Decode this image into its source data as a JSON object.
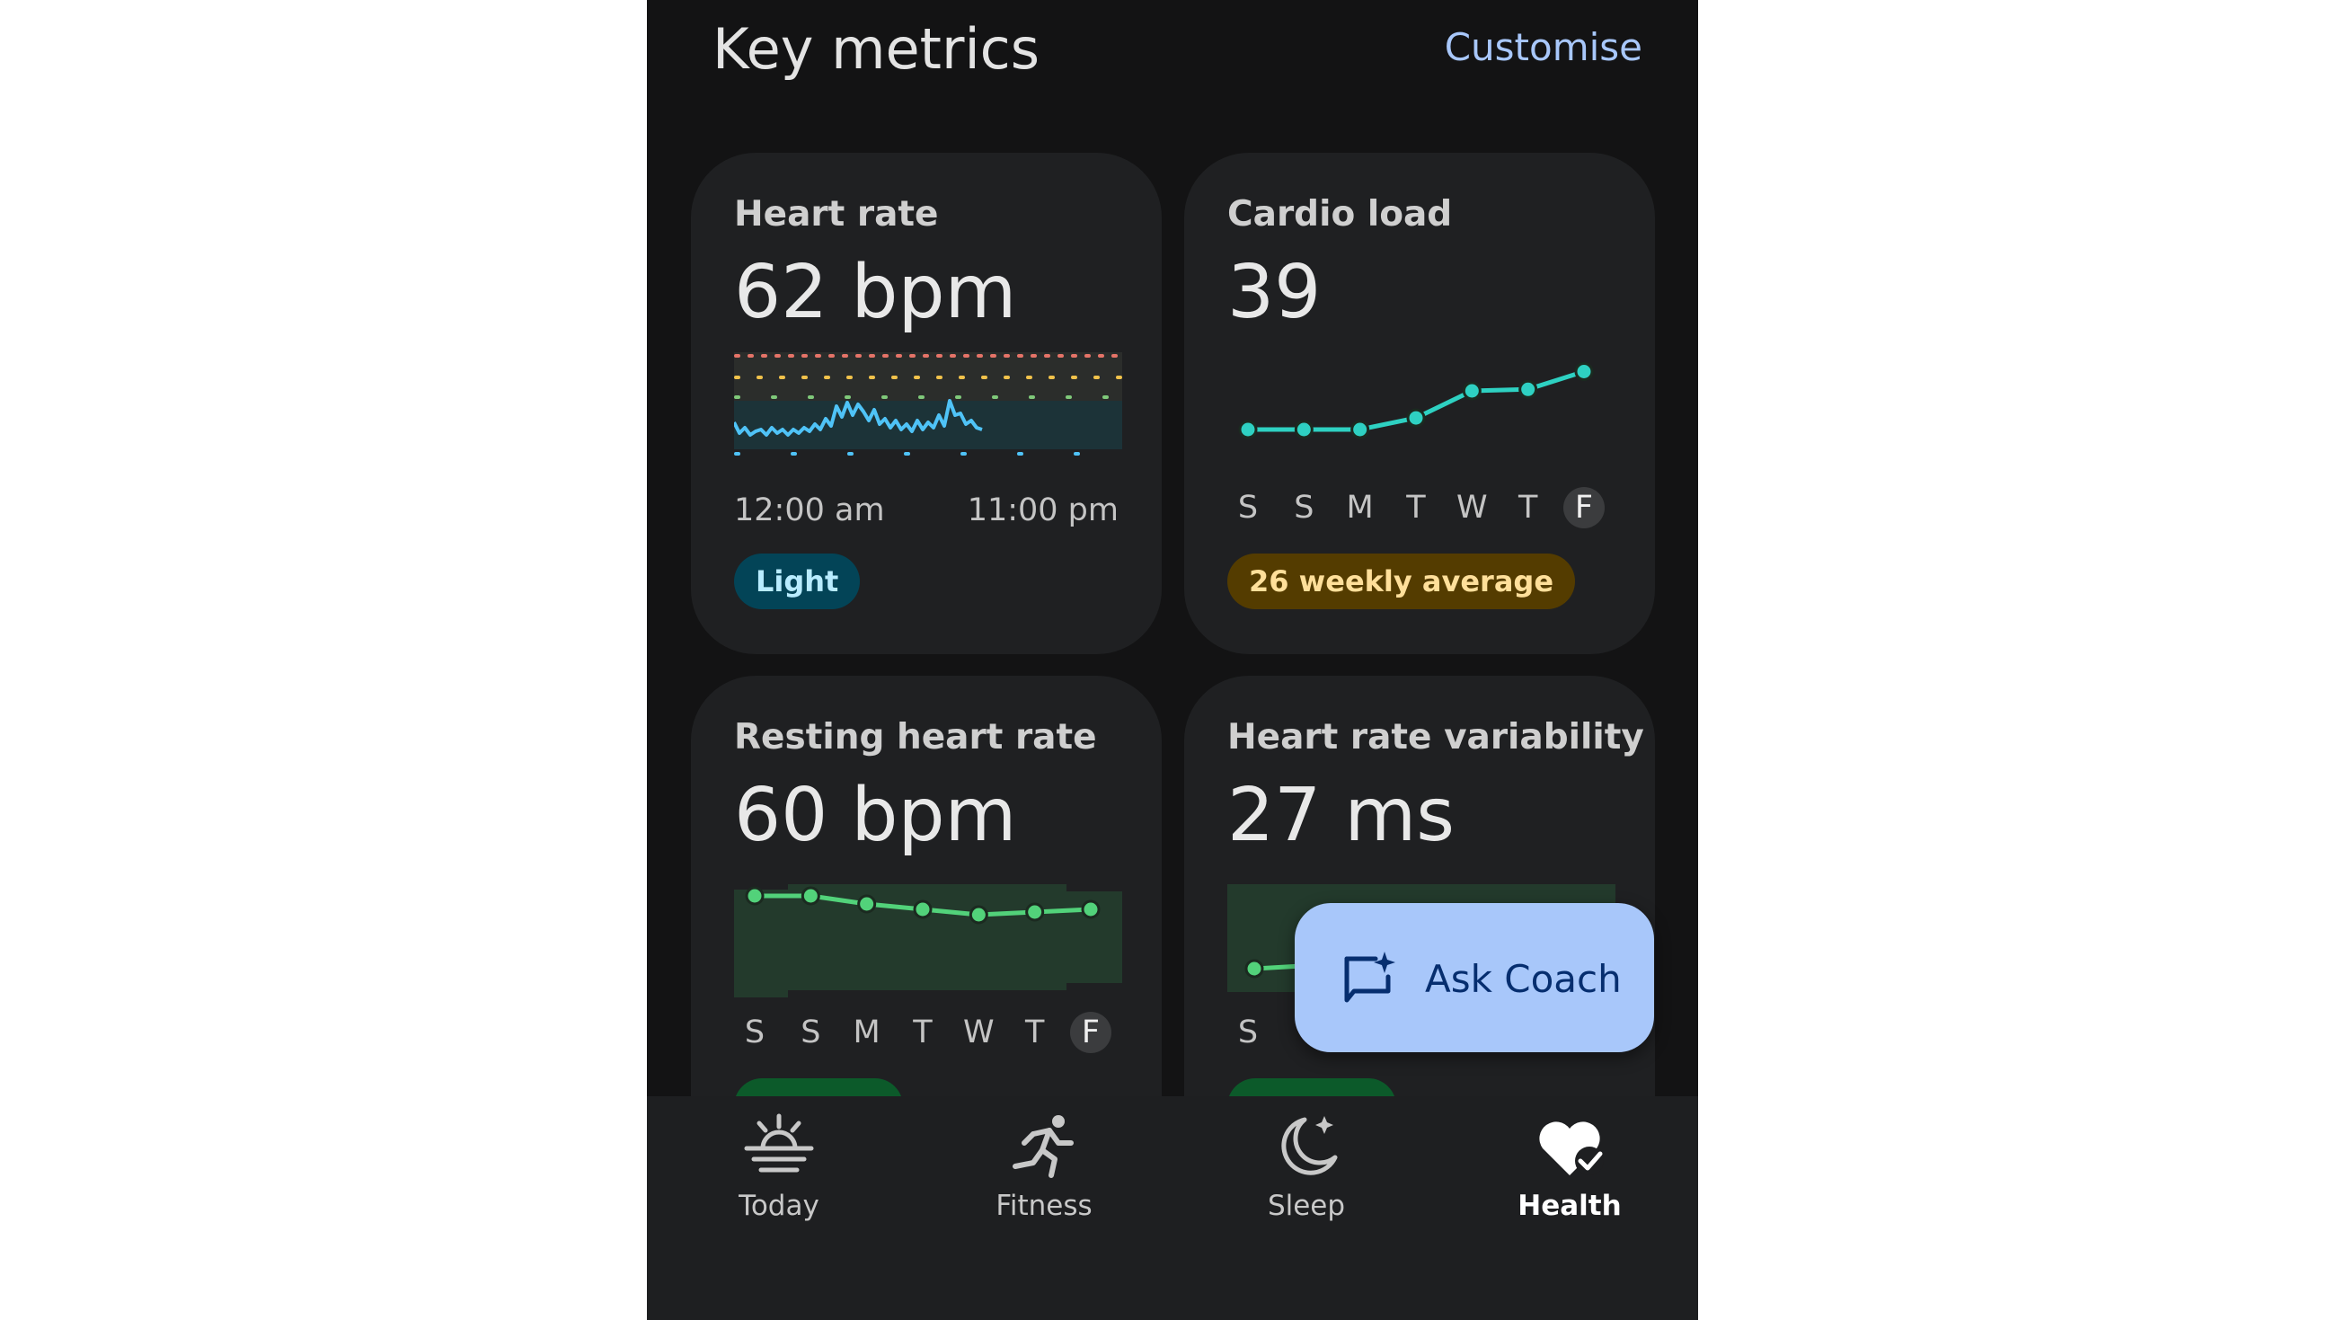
{
  "header": {
    "title": "Key metrics",
    "customise_label": "Customise"
  },
  "days": [
    "S",
    "S",
    "M",
    "T",
    "W",
    "T",
    "F"
  ],
  "cards": {
    "heart_rate": {
      "title": "Heart rate",
      "value": "62 bpm",
      "start_time": "12:00 am",
      "end_time": "11:00 pm",
      "zone_label": "Light",
      "zone_colors": [
        "#e57368",
        "#f1c24b",
        "#7fc97a"
      ],
      "line_color": "#4fc3f7"
    },
    "cardio_load": {
      "title": "Cardio load",
      "value": "39",
      "badge": "26 weekly average",
      "line_color": "#2ed1c2",
      "values": [
        0,
        0,
        0,
        0.15,
        0.5,
        0.52,
        0.75
      ]
    },
    "resting_heart_rate": {
      "title": "Resting heart rate",
      "value": "60 bpm",
      "line_color": "#52d27a",
      "values": [
        0.95,
        0.95,
        0.8,
        0.7,
        0.6,
        0.65,
        0.7
      ]
    },
    "hrv": {
      "title": "Heart rate variability",
      "value": "27 ms",
      "line_color": "#52d27a"
    }
  },
  "coach": {
    "label": "Ask Coach",
    "icon": "coach-chat-sparkle-icon"
  },
  "nav": {
    "items": [
      {
        "label": "Today",
        "icon": "sunrise-icon"
      },
      {
        "label": "Fitness",
        "icon": "runner-icon"
      },
      {
        "label": "Sleep",
        "icon": "moon-icon"
      },
      {
        "label": "Health",
        "icon": "heart-check-icon"
      }
    ],
    "active": "Health"
  },
  "colors": {
    "background": "#131314",
    "card": "#1f2022",
    "accent": "#a8c7fa"
  }
}
